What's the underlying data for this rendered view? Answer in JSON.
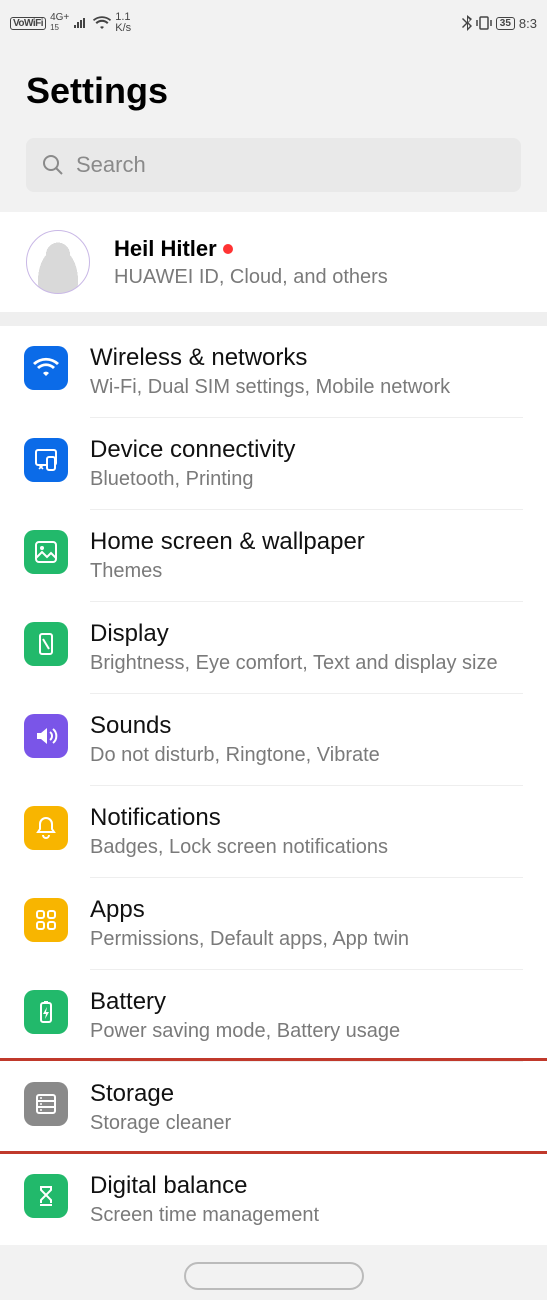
{
  "status_bar": {
    "vowifi": "VoWiFi",
    "net_top": "4G+",
    "net_bottom": "15",
    "speed_top": "1.1",
    "speed_bottom": "K/s",
    "battery": "35",
    "time": "8:3"
  },
  "page_title": "Settings",
  "search": {
    "placeholder": "Search"
  },
  "account": {
    "name": "Heil Hitler",
    "subtitle": "HUAWEI ID, Cloud, and others"
  },
  "items": [
    {
      "icon": "wifi",
      "color": "blue",
      "title": "Wireless & networks",
      "sub": "Wi-Fi, Dual SIM settings, Mobile network"
    },
    {
      "icon": "device",
      "color": "blue",
      "title": "Device connectivity",
      "sub": "Bluetooth, Printing"
    },
    {
      "icon": "wallpaper",
      "color": "green",
      "title": "Home screen & wallpaper",
      "sub": "Themes"
    },
    {
      "icon": "display",
      "color": "green",
      "title": "Display",
      "sub": "Brightness, Eye comfort, Text and display size"
    },
    {
      "icon": "sound",
      "color": "purple",
      "title": "Sounds",
      "sub": "Do not disturb, Ringtone, Vibrate"
    },
    {
      "icon": "bell",
      "color": "yellow",
      "title": "Notifications",
      "sub": "Badges, Lock screen notifications"
    },
    {
      "icon": "apps",
      "color": "yellow",
      "title": "Apps",
      "sub": "Permissions, Default apps, App twin"
    },
    {
      "icon": "battery",
      "color": "green",
      "title": "Battery",
      "sub": "Power saving mode, Battery usage"
    },
    {
      "icon": "storage",
      "color": "gray",
      "title": "Storage",
      "sub": "Storage cleaner",
      "highlighted": true
    },
    {
      "icon": "hourglass",
      "color": "green",
      "title": "Digital balance",
      "sub": "Screen time management"
    }
  ]
}
